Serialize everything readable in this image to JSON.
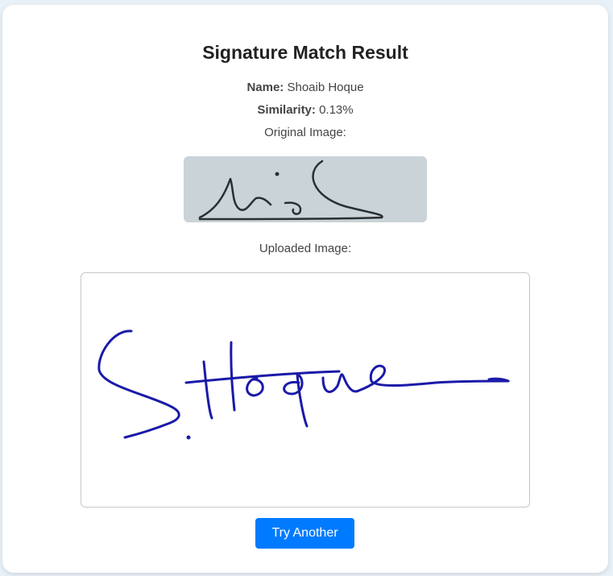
{
  "title": "Signature Match Result",
  "name_label": "Name:",
  "name_value": "Shoaib Hoque",
  "similarity_label": "Similarity:",
  "similarity_value": "0.13%",
  "original_label": "Original Image:",
  "uploaded_label": "Uploaded Image:",
  "button_label": "Try Another",
  "colors": {
    "accent": "#007bff",
    "ink_uploaded": "#1a1aa8",
    "ink_original": "#2a2f33"
  }
}
